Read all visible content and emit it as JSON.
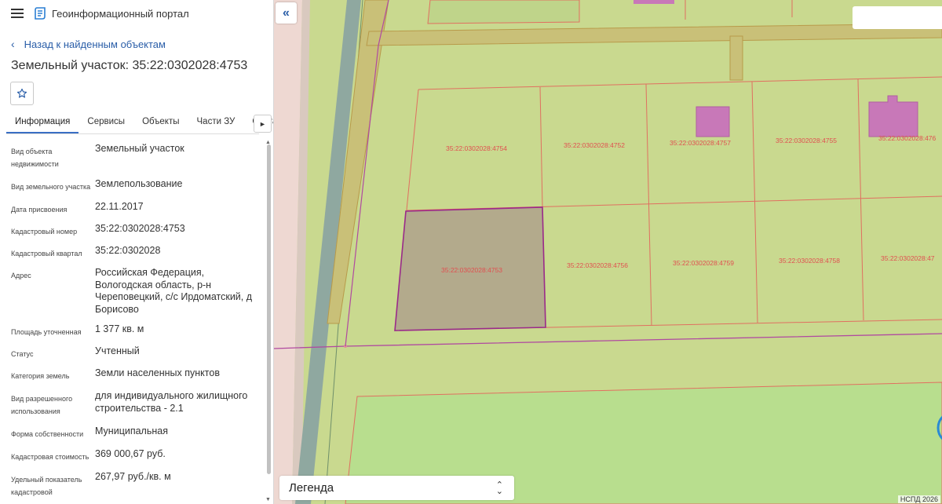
{
  "header": {
    "app_title": "Геоинформационный портал"
  },
  "nav": {
    "back_label": "Назад к найденным объектам"
  },
  "page": {
    "title": "Земельный участок: 35:22:0302028:4753"
  },
  "tabs": [
    {
      "label": "Информация",
      "active": true
    },
    {
      "label": "Сервисы"
    },
    {
      "label": "Объекты"
    },
    {
      "label": "Части ЗУ"
    },
    {
      "label": "Состав"
    }
  ],
  "info": [
    {
      "label": "Вид объекта недвижимости",
      "value": "Земельный участок"
    },
    {
      "label": "Вид земельного участка",
      "value": "Землепользование"
    },
    {
      "label": "Дата присвоения",
      "value": "22.11.2017"
    },
    {
      "label": "Кадастровый номер",
      "value": "35:22:0302028:4753"
    },
    {
      "label": "Кадастровый квартал",
      "value": "35:22:0302028"
    },
    {
      "label": "Адрес",
      "value": "Российская Федерация, Вологодская область, р-н Череповецкий, с/с Ирдоматский, д Борисово"
    },
    {
      "label": "Площадь уточненная",
      "value": "1 377 кв. м"
    },
    {
      "label": "Статус",
      "value": "Учтенный"
    },
    {
      "label": "Категория земель",
      "value": "Земли населенных пунктов"
    },
    {
      "label": "Вид разрешенного использования",
      "value": "для индивидуального жилищного строительства - 2.1"
    },
    {
      "label": "Форма собственности",
      "value": "Муниципальная"
    },
    {
      "label": "Кадастровая стоимость",
      "value": "369 000,67 руб."
    },
    {
      "label": "Удельный показатель кадастровой",
      "value": "267,97 руб./кв. м"
    }
  ],
  "map": {
    "plots": [
      "35:22:0302028:4754",
      "35:22:0302028:4752",
      "35:22:0302028:4757",
      "35:22:0302028:4755",
      "35:22:0302028:476",
      "35:22:0302028:4753",
      "35:22:0302028:4756",
      "35:22:0302028:4759",
      "35:22:0302028:4758",
      "35:22:0302028:47"
    ],
    "selected_plot": "35:22:0302028:4753",
    "legend_label": "Легенда",
    "copyright": "НСПД 2026",
    "colors": {
      "land": "#c9d98f",
      "selected_fill": "#b3aa8c",
      "boundary": "#e07060",
      "selected_border": "#9a2a8a",
      "building": "#c878b8",
      "road": "#8fa8a0"
    }
  },
  "icons": {
    "menu": "hamburger-icon",
    "logo": "portal-logo-icon",
    "back": "chevron-left-icon",
    "favorite": "star-outline-icon",
    "tabs_next": "chevron-right-icon",
    "collapse": "double-chevron-left-icon",
    "legend_toggle": "chevron-updown-icon"
  }
}
